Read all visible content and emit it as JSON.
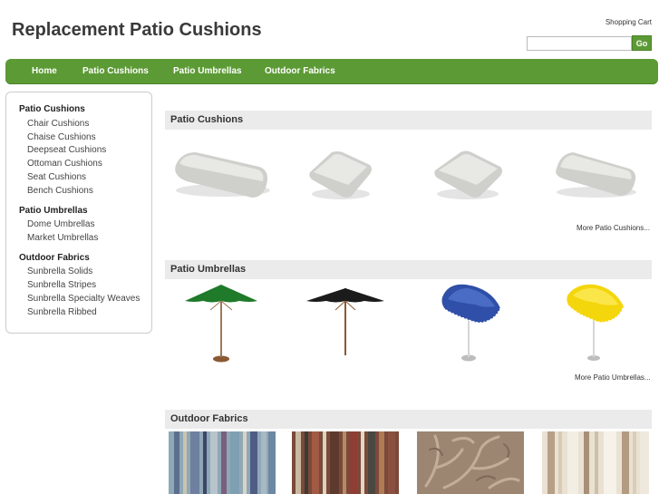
{
  "header": {
    "site_title": "Replacement Patio Cushions",
    "cart_label": "Shopping Cart",
    "search_value": "",
    "go_label": "Go"
  },
  "nav": {
    "items": [
      {
        "label": "Home"
      },
      {
        "label": "Patio Cushions"
      },
      {
        "label": "Patio Umbrellas"
      },
      {
        "label": "Outdoor Fabrics"
      }
    ]
  },
  "sidebar": {
    "groups": [
      {
        "title": "Patio Cushions",
        "items": [
          "Chair Cushions",
          "Chaise Cushions",
          "Deepseat Cushions",
          "Ottoman Cushions",
          "Seat Cushions",
          "Bench Cushions"
        ]
      },
      {
        "title": "Patio Umbrellas",
        "items": [
          "Dome Umbrellas",
          "Market Umbrellas"
        ]
      },
      {
        "title": "Outdoor Fabrics",
        "items": [
          "Sunbrella Solids",
          "Sunbrella Stripes",
          "Sunbrella Specialty Weaves",
          "Sunbrella Ribbed"
        ]
      }
    ]
  },
  "sections": {
    "cushions": {
      "title": "Patio Cushions",
      "more": "More Patio Cushions..."
    },
    "umbrellas": {
      "title": "Patio Umbrellas",
      "more": "More Patio Umbrellas..."
    },
    "fabrics": {
      "title": "Outdoor Fabrics"
    }
  },
  "colors": {
    "brand_green": "#5c9a35",
    "section_bar": "#ebebeb",
    "umbrella_green": "#1f7a2a",
    "umbrella_black": "#1b1b1b",
    "umbrella_blue": "#2f4fa8",
    "umbrella_yellow": "#f4d60c"
  }
}
